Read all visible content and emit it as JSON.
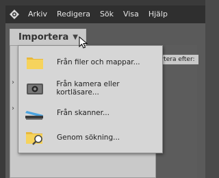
{
  "menubar": {
    "app_icon": "elements-organizer-icon",
    "items": [
      "Arkiv",
      "Redigera",
      "Sök",
      "Visa",
      "Hjälp"
    ]
  },
  "import_button": {
    "label": "Importera",
    "icon": "chevron-down-icon"
  },
  "sort_hint": "ortera efter:",
  "dropdown": {
    "items": [
      {
        "label": "Från filer och mappar...",
        "icon": "folder-icon"
      },
      {
        "label": "Från kamera eller kortläsare...",
        "icon": "camera-icon"
      },
      {
        "label": "Från skanner...",
        "icon": "scanner-icon"
      },
      {
        "label": "Genom sökning...",
        "icon": "folder-search-icon"
      }
    ]
  },
  "colors": {
    "menubar_bg": "#2f2f2f",
    "menu_bg": "#d6d6d6",
    "panel_bg": "#c9c9c9",
    "folder_yellow": "#f2c84b"
  }
}
